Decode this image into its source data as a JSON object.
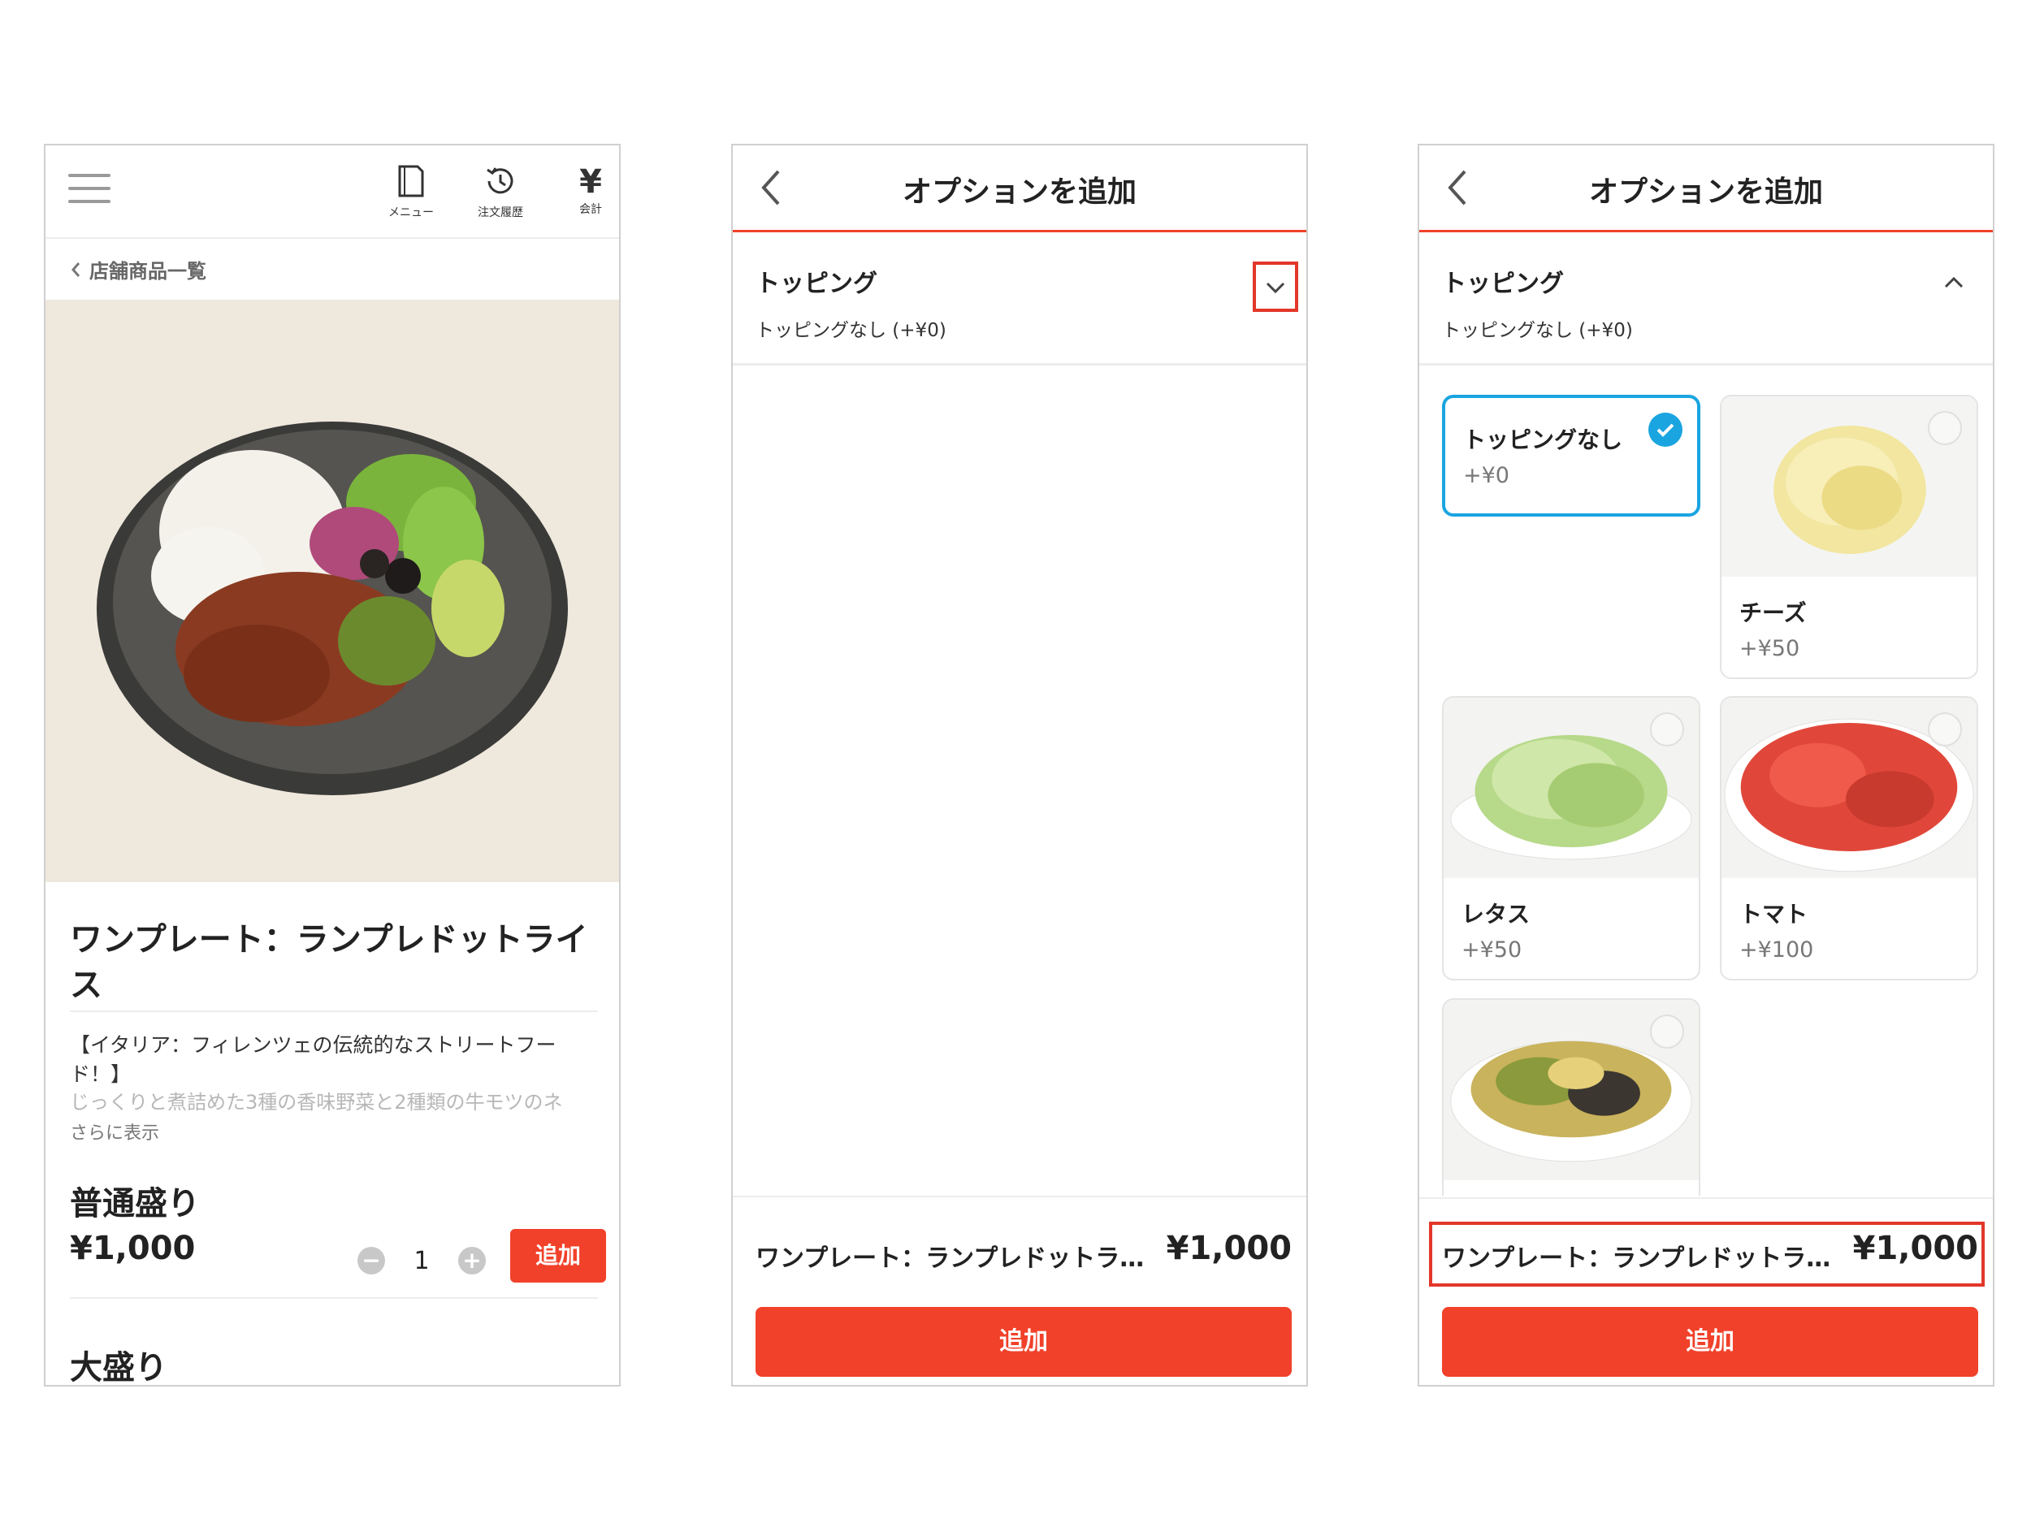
{
  "screen1": {
    "header": {
      "menu_label": "メニュー",
      "history_label": "注文履歴",
      "checkout_symbol": "¥",
      "checkout_label": "会計"
    },
    "breadcrumb": "店舗商品一覧",
    "product_title": "ワンプレート：ランプレドットライス",
    "description_lead": "【イタリア：フィレンツェの伝統的なストリートフード！】",
    "description_rest": "じっくりと煮詰めた3種の香味野菜と2種類の牛モツのネ",
    "more_label": "さらに表示",
    "sizes": [
      {
        "label": "普通盛り",
        "price": "¥1,000",
        "quantity": "1",
        "add_label": "追加"
      },
      {
        "label": "大盛り"
      }
    ],
    "stepper_minus": "−",
    "stepper_plus": "+"
  },
  "screen2": {
    "title": "オプションを追加",
    "section_title": "トッピング",
    "section_selected": "トッピングなし (+¥0)",
    "footer_name": "ワンプレート：ランプレドットラ…",
    "footer_price": "¥1,000",
    "add_label": "追加"
  },
  "screen3": {
    "title": "オプションを追加",
    "section_title": "トッピング",
    "section_selected": "トッピングなし (+¥0)",
    "options": [
      {
        "name": "トッピングなし",
        "price": "+¥0",
        "selected": true
      },
      {
        "name": "チーズ",
        "price": "+¥50",
        "selected": false
      },
      {
        "name": "レタス",
        "price": "+¥50",
        "selected": false
      },
      {
        "name": "トマト",
        "price": "+¥100",
        "selected": false
      },
      {
        "name": "",
        "price": "",
        "selected": false
      }
    ],
    "footer_name": "ワンプレート：ランプレドットラ…",
    "footer_price": "¥1,000",
    "add_label": "追加"
  },
  "colors": {
    "accent": "#f1412a",
    "highlight": "#e2372a",
    "selected": "#1aa5e0",
    "photo_bg": "#efe8dd"
  }
}
